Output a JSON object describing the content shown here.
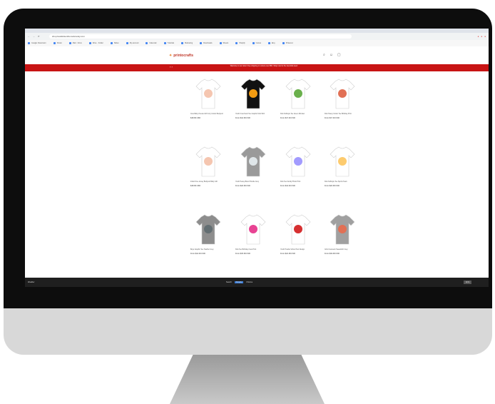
{
  "browser": {
    "url": "shop.bestkidsontherockcandy.com",
    "bookmarks": [
      "Google Classroom",
      "Finder",
      "Mail · Inbox",
      "Drive · Folder",
      "Slides",
      "My account",
      "Calendar",
      "Tutorials",
      "Marketing",
      "Downloads",
      "Sheets",
      "Shopify",
      "Canva",
      "Etsy",
      "Pinterest"
    ]
  },
  "site": {
    "logo": "printocrafts",
    "promo": "Welcome to our store! Free shipping on orders over $50. Shop now for the best kids tees!"
  },
  "products": [
    {
      "title": "Cute Baby Onesie Gift Cozy Cotton Bodysuit",
      "price": "$18.99 USD",
      "shirt": "#ffffff",
      "design": "#f5c6b0"
    },
    {
      "title": "Youth Crew Neck Tee Graphic Kids Shirt",
      "price": "From $14.99 USD",
      "shirt": "#111111",
      "design": "#f39c12"
    },
    {
      "title": "Kids Softstyle Tee Green Monster",
      "price": "From $17.49 USD",
      "shirt": "#ffffff",
      "design": "#6ab04c"
    },
    {
      "title": "Kids Heavy Cotton Tee Birthday Print",
      "price": "From $17.49 USD",
      "shirt": "#ffffff",
      "design": "#e17055"
    },
    {
      "title": "Infant Fine Jersey Bodysuit Baby Gift",
      "price": "$18.99 USD",
      "shirt": "#ffffff",
      "design": "#f5c6b0"
    },
    {
      "title": "Youth Heavy Blend Hoodie Grey",
      "price": "From $24.99 USD",
      "shirt": "#9a9a9a",
      "design": "#dfe6e9"
    },
    {
      "title": "Kids Tee Family Photo Print",
      "price": "From $14.49 USD",
      "shirt": "#ffffff",
      "design": "#a29bfe"
    },
    {
      "title": "Kids Softstyle Tee Sports Team",
      "price": "From $24.99 USD",
      "shirt": "#ffffff",
      "design": "#fdcb6e"
    },
    {
      "title": "Boys Graphic Tee Heather Grey",
      "price": "From $14.49 USD",
      "shirt": "#8d8d8d",
      "design": "#636e72"
    },
    {
      "title": "Kids Tee Birthday Crew Print",
      "price": "From $15.99 USD",
      "shirt": "#ffffff",
      "design": "#e84393"
    },
    {
      "title": "Youth Hoodie School Text Design",
      "price": "From $21.99 USD",
      "shirt": "#ffffff",
      "design": "#d63031"
    },
    {
      "title": "Girls Crewneck Sweatshirt Grey",
      "price": "From $19.99 USD",
      "shirt": "#a0a0a0",
      "design": "#e17055"
    }
  ],
  "taskbar": {
    "left": "Weather",
    "mid": [
      "Search",
      "Shopify",
      "Chrome"
    ],
    "right": "ENG"
  }
}
